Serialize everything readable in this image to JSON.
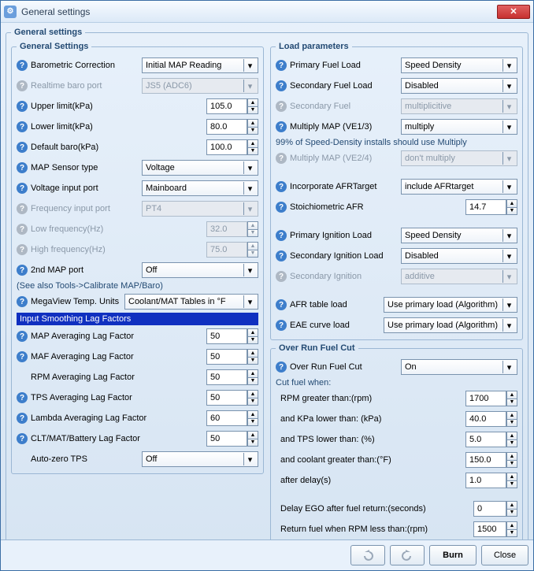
{
  "window": {
    "title": "General settings"
  },
  "outer_legend": "General settings",
  "left": {
    "legend": "General Settings",
    "baro_correction": {
      "label": "Barometric Correction",
      "value": "Initial MAP Reading"
    },
    "realtime_baro_port": {
      "label": "Realtime baro port",
      "value": "JS5 (ADC6)"
    },
    "upper_limit": {
      "label": "Upper limit(kPa)",
      "value": "105.0"
    },
    "lower_limit": {
      "label": "Lower limit(kPa)",
      "value": "80.0"
    },
    "default_baro": {
      "label": "Default baro(kPa)",
      "value": "100.0"
    },
    "map_sensor": {
      "label": "MAP Sensor type",
      "value": "Voltage"
    },
    "voltage_port": {
      "label": "Voltage input port",
      "value": "Mainboard"
    },
    "freq_port": {
      "label": "Frequency input port",
      "value": "PT4"
    },
    "low_freq": {
      "label": "Low frequency(Hz)",
      "value": "32.0"
    },
    "high_freq": {
      "label": "High frequency(Hz)",
      "value": "75.0"
    },
    "second_map": {
      "label": "2nd MAP port",
      "value": "Off"
    },
    "note": "(See also Tools->Calibrate MAP/Baro)",
    "megaview": {
      "label": "MegaView Temp. Units",
      "value": "Coolant/MAT Tables in °F"
    },
    "lag_header": "Input Smoothing Lag Factors",
    "map_lag": {
      "label": "MAP Averaging Lag Factor",
      "value": "50"
    },
    "maf_lag": {
      "label": "MAF Averaging Lag Factor",
      "value": "50"
    },
    "rpm_lag": {
      "label": "RPM Averaging Lag Factor",
      "value": "50"
    },
    "tps_lag": {
      "label": "TPS Averaging Lag Factor",
      "value": "50"
    },
    "lambda_lag": {
      "label": "Lambda Averaging Lag Factor",
      "value": "60"
    },
    "clt_lag": {
      "label": "CLT/MAT/Battery Lag Factor",
      "value": "50"
    },
    "auto_zero": {
      "label": "Auto-zero TPS",
      "value": "Off"
    }
  },
  "right_load": {
    "legend": "Load parameters",
    "primary_fuel": {
      "label": "Primary Fuel Load",
      "value": "Speed Density"
    },
    "secondary_fuel": {
      "label": "Secondary Fuel Load",
      "value": "Disabled"
    },
    "secondary_fuel_alg": {
      "label": "Secondary Fuel",
      "value": "multiplicitive"
    },
    "multiply_map1": {
      "label": "Multiply MAP (VE1/3)",
      "value": "multiply"
    },
    "hint1": "99% of Speed-Density installs should use Multiply",
    "multiply_map2": {
      "label": "Multiply MAP (VE2/4)",
      "value": "don't multiply"
    },
    "afr_target": {
      "label": "Incorporate AFRTarget",
      "value": "include AFRtarget"
    },
    "stoich_afr": {
      "label": "Stoichiometric AFR",
      "value": "14.7"
    },
    "primary_ign": {
      "label": "Primary Ignition Load",
      "value": "Speed Density"
    },
    "secondary_ign": {
      "label": "Secondary Ignition Load",
      "value": "Disabled"
    },
    "secondary_ign_alg": {
      "label": "Secondary Ignition",
      "value": "additive"
    },
    "afr_table": {
      "label": "AFR table load",
      "value": "Use primary load (Algorithm)"
    },
    "eae_curve": {
      "label": "EAE curve load",
      "value": "Use primary load (Algorithm)"
    }
  },
  "right_over": {
    "legend": "Over Run Fuel Cut",
    "enable": {
      "label": "Over Run Fuel Cut",
      "value": "On"
    },
    "cut_when": "Cut fuel when:",
    "rpm_gt": {
      "label": "RPM greater than:(rpm)",
      "value": "1700"
    },
    "kpa_lt": {
      "label": "and KPa lower than:  (kPa)",
      "value": "40.0"
    },
    "tps_lt": {
      "label": "and TPS lower than:  (%)",
      "value": "5.0"
    },
    "clt_gt": {
      "label": "and coolant greater than:(°F)",
      "value": "150.0"
    },
    "delay": {
      "label": "after delay(s)",
      "value": "1.0"
    },
    "ego_delay": {
      "label": "Delay EGO after fuel return:(seconds)",
      "value": "0"
    },
    "rpm_return": {
      "label": "Return fuel when RPM less than:(rpm)",
      "value": "1500"
    }
  },
  "buttons": {
    "burn": "Burn",
    "close": "Close"
  }
}
